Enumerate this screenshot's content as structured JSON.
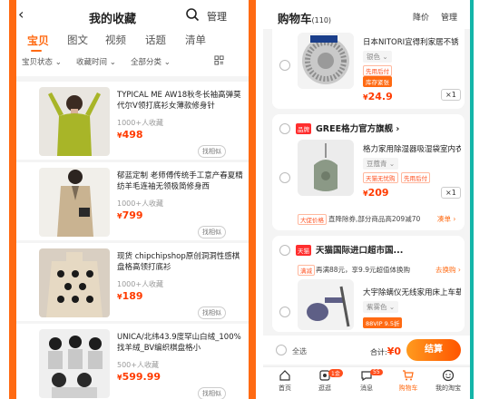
{
  "left_panel": {
    "header": {
      "back_icon": "chevron-left-icon",
      "title": "我的收藏",
      "manage": "管理",
      "search_icon": "search-icon"
    },
    "tabs": [
      "宝贝",
      "图文",
      "视频",
      "话题",
      "清单"
    ],
    "filters": [
      "宝贝状态 ⌄",
      "收藏时间 ⌄",
      "全部分类 ⌄"
    ],
    "items": [
      {
        "name": "TYPICAL ME AW18秋冬长袖高弹莫代尔V领打底衫女薄款修身针",
        "meta": "1000+人收藏",
        "price": "498",
        "similar": "找相似"
      },
      {
        "name": "郁蓝定制 老师傅传统手工意产春夏精纺羊毛连袖无领极简修身西",
        "meta": "1000+人收藏",
        "price": "799",
        "similar": "找相似"
      },
      {
        "name": "现货 chipchipshop原创洞洞性感棋盘格高领打底衫",
        "meta": "1000+人收藏",
        "price": "189",
        "similar": "找相似"
      },
      {
        "name": "UNICA/北纬43.9度罕山白绒_100%找羊绒_BV编织棋盘格小",
        "meta": "500+人收藏",
        "price": "599.99",
        "similar": "找相似"
      }
    ],
    "currency": "¥"
  },
  "right_panel": {
    "header": {
      "title": "购物车",
      "count": "(110)",
      "price_drop": "降价",
      "manage": "管理"
    },
    "cards": [
      {
        "name": "日本NITORI宜得利家居不锈",
        "sku": "银色 ⌄",
        "tags": [
          "先用后付",
          "库存紧张"
        ],
        "price": "24.9",
        "qty": "×1"
      },
      {
        "shop_badge": "品牌",
        "shop": "GREE格力官方旗舰 ›",
        "name": "格力家用除湿器吸湿袋室内衣",
        "sku": "豆蔻青 ⌄",
        "tags": [
          "天猫无忧购",
          "先用后付"
        ],
        "price": "209",
        "qty": "×1",
        "coupon_tag": "大促价格",
        "coupon": "直降除券,部分商品高209减70",
        "coupon_link": "凑单 ›"
      },
      {
        "shop_badge": "天猫",
        "shop": "天猫国际进口超市国...",
        "promo_tag": "满减",
        "promo": "再满88元，享9.9元超值体换购",
        "promo_link": "去换购 ›",
        "name": "大宇除螨仪无线家用床上车载",
        "sku": "紫雾色 ⌄",
        "tags": [
          "88VIP 9.5折"
        ]
      }
    ],
    "footer": {
      "select_all": "全选",
      "total_label": "合计:",
      "total_value": "¥0",
      "checkout": "结算"
    },
    "nav": [
      {
        "label": "首页",
        "icon": "home-icon"
      },
      {
        "label": "逛逛",
        "icon": "discover-icon",
        "badge": "1金"
      },
      {
        "label": "消息",
        "icon": "message-icon",
        "badge": "55"
      },
      {
        "label": "购物车",
        "icon": "cart-icon"
      },
      {
        "label": "我的淘宝",
        "icon": "profile-icon"
      }
    ],
    "colors": {
      "accent": "#ff6a12",
      "price": "#ff3b00",
      "teal_edge": "#14b5a8"
    }
  }
}
